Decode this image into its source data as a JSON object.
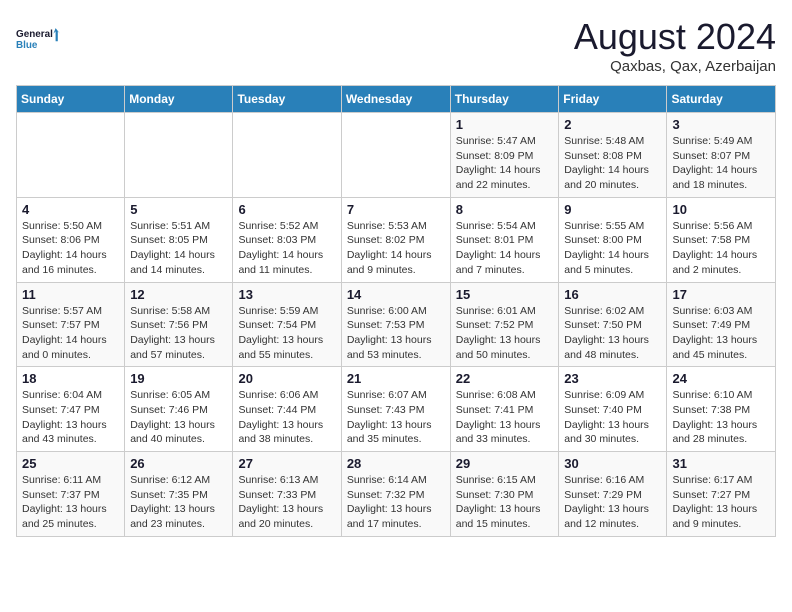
{
  "header": {
    "logo_line1": "General",
    "logo_line2": "Blue",
    "month_year": "August 2024",
    "location": "Qaxbas, Qax, Azerbaijan"
  },
  "weekdays": [
    "Sunday",
    "Monday",
    "Tuesday",
    "Wednesday",
    "Thursday",
    "Friday",
    "Saturday"
  ],
  "weeks": [
    [
      {
        "day": "",
        "info": ""
      },
      {
        "day": "",
        "info": ""
      },
      {
        "day": "",
        "info": ""
      },
      {
        "day": "",
        "info": ""
      },
      {
        "day": "1",
        "info": "Sunrise: 5:47 AM\nSunset: 8:09 PM\nDaylight: 14 hours\nand 22 minutes."
      },
      {
        "day": "2",
        "info": "Sunrise: 5:48 AM\nSunset: 8:08 PM\nDaylight: 14 hours\nand 20 minutes."
      },
      {
        "day": "3",
        "info": "Sunrise: 5:49 AM\nSunset: 8:07 PM\nDaylight: 14 hours\nand 18 minutes."
      }
    ],
    [
      {
        "day": "4",
        "info": "Sunrise: 5:50 AM\nSunset: 8:06 PM\nDaylight: 14 hours\nand 16 minutes."
      },
      {
        "day": "5",
        "info": "Sunrise: 5:51 AM\nSunset: 8:05 PM\nDaylight: 14 hours\nand 14 minutes."
      },
      {
        "day": "6",
        "info": "Sunrise: 5:52 AM\nSunset: 8:03 PM\nDaylight: 14 hours\nand 11 minutes."
      },
      {
        "day": "7",
        "info": "Sunrise: 5:53 AM\nSunset: 8:02 PM\nDaylight: 14 hours\nand 9 minutes."
      },
      {
        "day": "8",
        "info": "Sunrise: 5:54 AM\nSunset: 8:01 PM\nDaylight: 14 hours\nand 7 minutes."
      },
      {
        "day": "9",
        "info": "Sunrise: 5:55 AM\nSunset: 8:00 PM\nDaylight: 14 hours\nand 5 minutes."
      },
      {
        "day": "10",
        "info": "Sunrise: 5:56 AM\nSunset: 7:58 PM\nDaylight: 14 hours\nand 2 minutes."
      }
    ],
    [
      {
        "day": "11",
        "info": "Sunrise: 5:57 AM\nSunset: 7:57 PM\nDaylight: 14 hours\nand 0 minutes."
      },
      {
        "day": "12",
        "info": "Sunrise: 5:58 AM\nSunset: 7:56 PM\nDaylight: 13 hours\nand 57 minutes."
      },
      {
        "day": "13",
        "info": "Sunrise: 5:59 AM\nSunset: 7:54 PM\nDaylight: 13 hours\nand 55 minutes."
      },
      {
        "day": "14",
        "info": "Sunrise: 6:00 AM\nSunset: 7:53 PM\nDaylight: 13 hours\nand 53 minutes."
      },
      {
        "day": "15",
        "info": "Sunrise: 6:01 AM\nSunset: 7:52 PM\nDaylight: 13 hours\nand 50 minutes."
      },
      {
        "day": "16",
        "info": "Sunrise: 6:02 AM\nSunset: 7:50 PM\nDaylight: 13 hours\nand 48 minutes."
      },
      {
        "day": "17",
        "info": "Sunrise: 6:03 AM\nSunset: 7:49 PM\nDaylight: 13 hours\nand 45 minutes."
      }
    ],
    [
      {
        "day": "18",
        "info": "Sunrise: 6:04 AM\nSunset: 7:47 PM\nDaylight: 13 hours\nand 43 minutes."
      },
      {
        "day": "19",
        "info": "Sunrise: 6:05 AM\nSunset: 7:46 PM\nDaylight: 13 hours\nand 40 minutes."
      },
      {
        "day": "20",
        "info": "Sunrise: 6:06 AM\nSunset: 7:44 PM\nDaylight: 13 hours\nand 38 minutes."
      },
      {
        "day": "21",
        "info": "Sunrise: 6:07 AM\nSunset: 7:43 PM\nDaylight: 13 hours\nand 35 minutes."
      },
      {
        "day": "22",
        "info": "Sunrise: 6:08 AM\nSunset: 7:41 PM\nDaylight: 13 hours\nand 33 minutes."
      },
      {
        "day": "23",
        "info": "Sunrise: 6:09 AM\nSunset: 7:40 PM\nDaylight: 13 hours\nand 30 minutes."
      },
      {
        "day": "24",
        "info": "Sunrise: 6:10 AM\nSunset: 7:38 PM\nDaylight: 13 hours\nand 28 minutes."
      }
    ],
    [
      {
        "day": "25",
        "info": "Sunrise: 6:11 AM\nSunset: 7:37 PM\nDaylight: 13 hours\nand 25 minutes."
      },
      {
        "day": "26",
        "info": "Sunrise: 6:12 AM\nSunset: 7:35 PM\nDaylight: 13 hours\nand 23 minutes."
      },
      {
        "day": "27",
        "info": "Sunrise: 6:13 AM\nSunset: 7:33 PM\nDaylight: 13 hours\nand 20 minutes."
      },
      {
        "day": "28",
        "info": "Sunrise: 6:14 AM\nSunset: 7:32 PM\nDaylight: 13 hours\nand 17 minutes."
      },
      {
        "day": "29",
        "info": "Sunrise: 6:15 AM\nSunset: 7:30 PM\nDaylight: 13 hours\nand 15 minutes."
      },
      {
        "day": "30",
        "info": "Sunrise: 6:16 AM\nSunset: 7:29 PM\nDaylight: 13 hours\nand 12 minutes."
      },
      {
        "day": "31",
        "info": "Sunrise: 6:17 AM\nSunset: 7:27 PM\nDaylight: 13 hours\nand 9 minutes."
      }
    ]
  ]
}
